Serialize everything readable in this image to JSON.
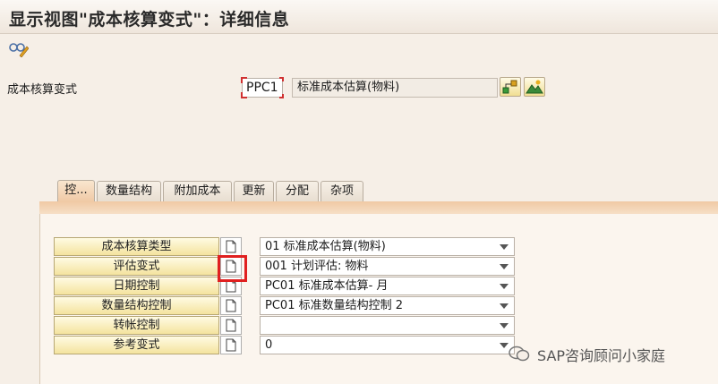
{
  "window": {
    "title": "显示视图\"成本核算变式\"：详细信息"
  },
  "header_row": {
    "label": "成本核算变式",
    "code": "PPC1",
    "description": "标准成本估算(物料)"
  },
  "tabs": [
    {
      "label": "控..."
    },
    {
      "label": "数量结构"
    },
    {
      "label": "附加成本"
    },
    {
      "label": "更新"
    },
    {
      "label": "分配"
    },
    {
      "label": "杂项"
    }
  ],
  "fields": [
    {
      "label": "成本核算类型",
      "value": "01 标准成本估算(物料)"
    },
    {
      "label": "评估变式",
      "value": "001 计划评估: 物料"
    },
    {
      "label": "日期控制",
      "value": "PC01 标准成本估算- 月"
    },
    {
      "label": "数量结构控制",
      "value": "PC01 标准数量结构控制 2"
    },
    {
      "label": "转帐控制",
      "value": ""
    },
    {
      "label": "参考变式",
      "value": "0"
    }
  ],
  "watermark": {
    "text": "SAP咨询顾问小家庭"
  },
  "colors": {
    "accent_tab": "#efc7a2",
    "button_yellow": "#f4e39e",
    "highlight": "#e02020"
  }
}
